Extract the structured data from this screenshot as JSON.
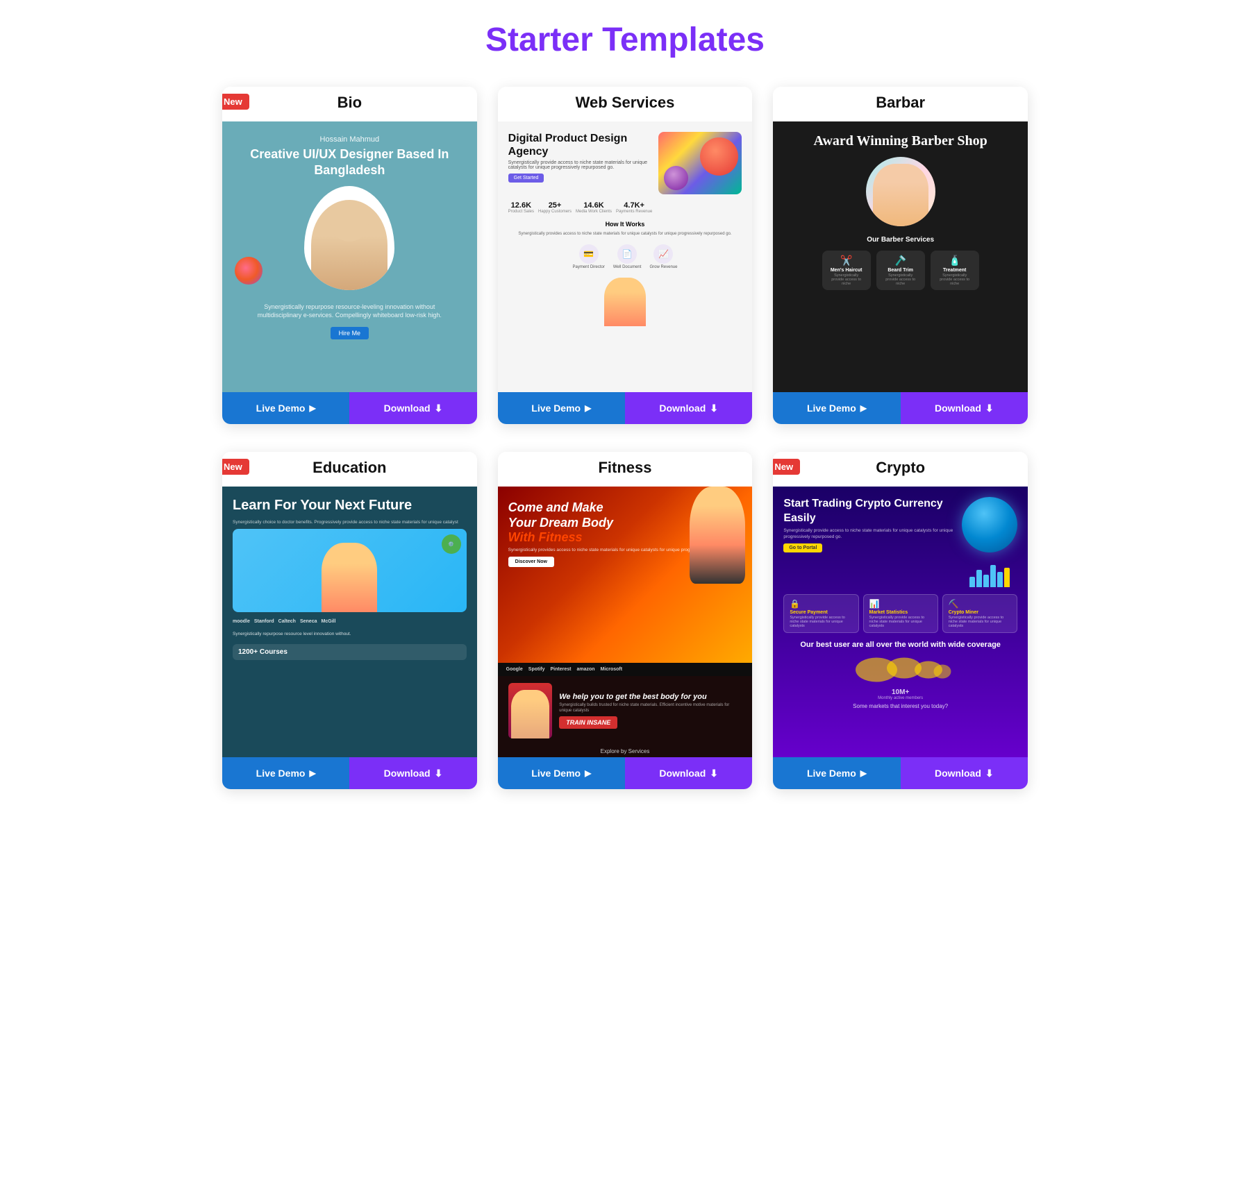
{
  "page": {
    "title": "Starter Templates"
  },
  "cards": [
    {
      "id": "bio",
      "title": "Bio",
      "badge": "New",
      "live_demo_label": "Live Demo",
      "download_label": "Download",
      "preview": {
        "name": "Hossain Mahmud",
        "headline": "Creative UI/UX Designer Based In Bangladesh",
        "desc": "Synergistically repurpose resource-leveling innovation without multidisciplinary e-services. Compellingly whiteboard low-risk high.",
        "btn": "Hire Me"
      }
    },
    {
      "id": "web-services",
      "title": "Web Services",
      "badge": null,
      "live_demo_label": "Live Demo",
      "download_label": "Download",
      "preview": {
        "headline": "Digital Product Design Agency",
        "stats": [
          {
            "val": "12.6K",
            "lbl": "Product Sales"
          },
          {
            "val": "25+",
            "lbl": "Happy Customers"
          },
          {
            "val": "14.6K",
            "lbl": "Media Work Clients"
          },
          {
            "val": "4.7K+",
            "lbl": "Payments Revenue"
          }
        ],
        "how_it_works": "How It Works",
        "icons": [
          "💳",
          "📄",
          "📈"
        ],
        "icon_labels": [
          "Payment Director",
          "Well Document",
          "Grow Revenue"
        ]
      }
    },
    {
      "id": "barbar",
      "title": "Barbar",
      "badge": null,
      "live_demo_label": "Live Demo",
      "download_label": "Download",
      "preview": {
        "headline": "Award Winning Barber Shop",
        "services_title": "Our Barber Services",
        "services": [
          {
            "icon": "✂️",
            "name": "Men's Haircut",
            "desc": "Synergistically provide access to niche"
          },
          {
            "icon": "🪒",
            "name": "Beard Trim",
            "desc": "Synergistically provide access to niche"
          },
          {
            "icon": "🧴",
            "name": "Treatment",
            "desc": "Synergistically provide access to niche"
          }
        ]
      }
    },
    {
      "id": "education",
      "title": "Education",
      "badge": "New",
      "live_demo_label": "Live Demo",
      "download_label": "Download",
      "preview": {
        "headline": "Learn For Your Next Future",
        "sub": "Synergistically choice to doctor benefits. Progressively provide access to niche state materials for unique catalyst",
        "logos": [
          "moodle",
          "Stanford",
          "Caltech",
          "Seneca",
          "McGill"
        ],
        "desc": "Synergistically repurpose resource level innovation without.",
        "courses": "1200+ Courses"
      }
    },
    {
      "id": "fitness",
      "title": "Fitness",
      "badge": null,
      "live_demo_label": "Live Demo",
      "download_label": "Download",
      "preview": {
        "headline": "Come and Make Your Dream Body With Fitness",
        "sub": "Synergistically provides access to niche state materials for unique catalysts for unique progressively repurposed",
        "cta": "Discover Now",
        "logos": [
          "Google",
          "Spotify",
          "Pinterest",
          "amazon",
          "Microsoft"
        ],
        "section_headline": "We help you to get the best body for you",
        "section_sub": "Synergistically builds trusted for niche state materials. Efficient incentive motive materials for unique catalysts",
        "tag": "TRAIN INSANE",
        "explore": "Explore by Services"
      }
    },
    {
      "id": "crypto",
      "title": "Crypto",
      "badge": "New",
      "live_demo_label": "Live Demo",
      "download_label": "Download",
      "preview": {
        "headline": "Start Trading Crypto Currency Easily",
        "sub": "Synergistically provide access to niche state materials for unique catalysts for unique progressively repurposed go.",
        "btn": "Go to Portal",
        "cards": [
          {
            "icon": "🔒",
            "title": "Secure Payment",
            "desc": "Synergistically provide access to niche state materials for unique catalysts"
          },
          {
            "icon": "📊",
            "title": "Market Statistics",
            "desc": "Synergistically provide access to niche state materials for unique catalysts"
          },
          {
            "icon": "⛏️",
            "title": "Crypto Miner",
            "desc": "Synergistically provide access to niche state materials for unique catalysts"
          }
        ],
        "world_text": "Our best user are all over the world with wide coverage",
        "users": "10M+",
        "users_lbl": "Monthly active members",
        "question": "Some markets that interest you today?"
      }
    }
  ]
}
